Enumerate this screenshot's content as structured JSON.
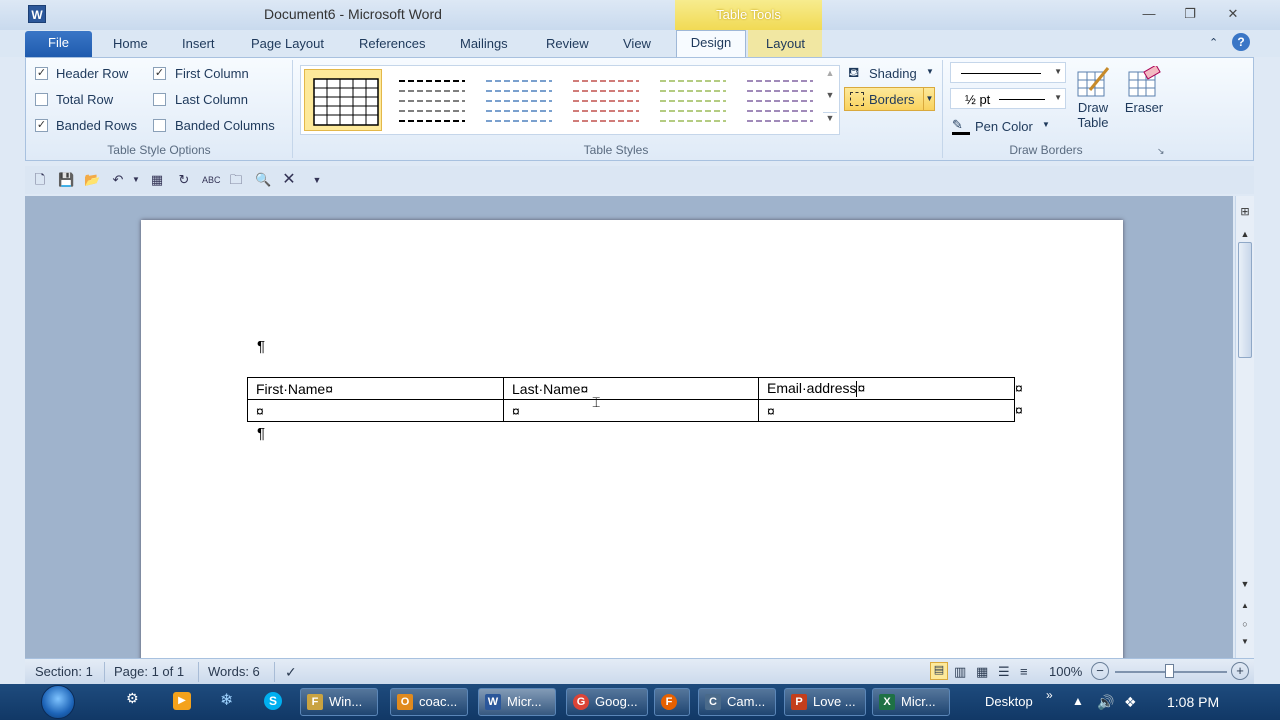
{
  "titlebar": {
    "app_icon": "W",
    "title": "Document6  -  Microsoft Word",
    "contextual_tab_group": "Table Tools",
    "minimize": "—",
    "restore": "❐",
    "close": "✕"
  },
  "tabs": {
    "file": "File",
    "home": "Home",
    "insert": "Insert",
    "page_layout": "Page Layout",
    "references": "References",
    "mailings": "Mailings",
    "review": "Review",
    "view": "View",
    "design": "Design",
    "layout": "Layout"
  },
  "table_style_options": {
    "label": "Table Style Options",
    "header_row": "Header Row",
    "total_row": "Total Row",
    "banded_rows": "Banded Rows",
    "first_column": "First Column",
    "last_column": "Last Column",
    "banded_columns": "Banded Columns",
    "checked_mark": "✓"
  },
  "table_styles": {
    "label": "Table Styles"
  },
  "draw_borders": {
    "label": "Draw Borders",
    "shading": "Shading",
    "borders": "Borders",
    "pen_weight": "½ pt",
    "pen_color": "Pen Color",
    "draw_table_line1": "Draw",
    "draw_table_line2": "Table",
    "eraser": "Eraser"
  },
  "document": {
    "pilcrow": "¶",
    "cell_mark": "¤",
    "table": {
      "headers": [
        "First·Name",
        "Last·Name",
        "Email·address"
      ],
      "rows": [
        [
          "",
          "",
          ""
        ]
      ]
    }
  },
  "statusbar": {
    "section": "Section: 1",
    "page": "Page: 1 of 1",
    "words": "Words: 6",
    "zoom": "100%",
    "zoom_out": "−",
    "zoom_in": "+"
  },
  "taskbar": {
    "items": [
      {
        "label": "Win...",
        "icon": "F",
        "color": "#c9a341"
      },
      {
        "label": "coac...",
        "icon": "O",
        "color": "#e08a1e"
      },
      {
        "label": "Micr...",
        "icon": "W",
        "color": "#2b579a"
      },
      {
        "label": "Goog...",
        "icon": "G",
        "color": "#db4437"
      },
      {
        "label": "",
        "icon": "F",
        "color": "#e66000"
      },
      {
        "label": "Cam...",
        "icon": "C",
        "color": "#4a6a8a"
      },
      {
        "label": "Love ...",
        "icon": "P",
        "color": "#c43e1c"
      },
      {
        "label": "Micr...",
        "icon": "X",
        "color": "#1e7145"
      }
    ],
    "desktop": "Desktop",
    "clock": "1:08 PM"
  }
}
